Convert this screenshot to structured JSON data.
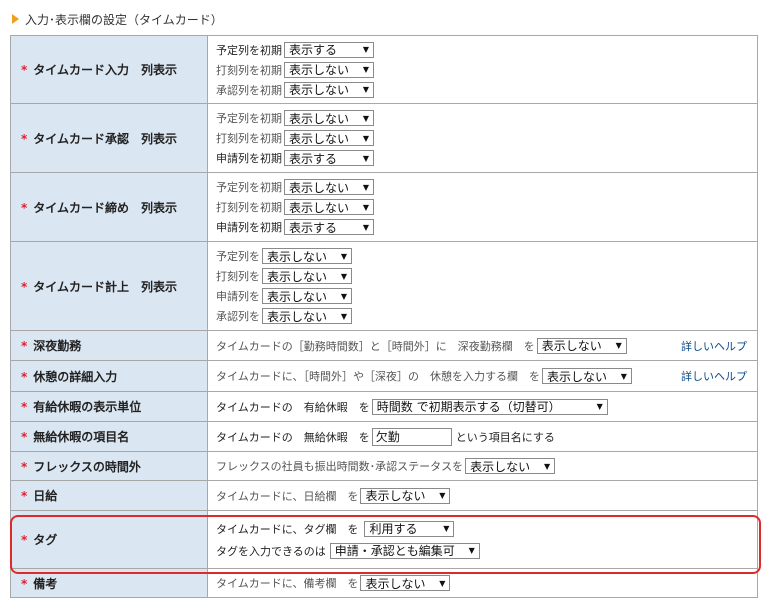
{
  "section": {
    "title": "入力･表示欄の設定（タイムカード）"
  },
  "rows": [
    {
      "label": "タイムカード入力　列表示",
      "lines": [
        {
          "text": "予定列を初期",
          "value": "表示する"
        },
        {
          "text": "打刻列を初期",
          "value": "表示しない"
        },
        {
          "text": "承認列を初期",
          "value": "表示しない"
        }
      ]
    },
    {
      "label": "タイムカード承認　列表示",
      "lines": [
        {
          "text": "予定列を初期",
          "value": "表示しない"
        },
        {
          "text": "打刻列を初期",
          "value": "表示しない"
        },
        {
          "text": "申請列を初期",
          "value": "表示する"
        }
      ]
    },
    {
      "label": "タイムカード締め　列表示",
      "lines": [
        {
          "text": "予定列を初期",
          "value": "表示しない"
        },
        {
          "text": "打刻列を初期",
          "value": "表示しない"
        },
        {
          "text": "申請列を初期",
          "value": "表示する"
        }
      ]
    },
    {
      "label": "タイムカード計上　列表示",
      "lines": [
        {
          "text": "予定列を",
          "value": "表示しない"
        },
        {
          "text": "打刻列を",
          "value": "表示しない"
        },
        {
          "text": "申請列を",
          "value": "表示しない"
        },
        {
          "text": "承認列を",
          "value": "表示しない"
        }
      ]
    },
    {
      "label": "深夜勤務",
      "text": "タイムカードの［勤務時間数］と［時間外］に　深夜勤務欄　を",
      "value": "表示しない",
      "help": "詳しいヘルプ"
    },
    {
      "label": "休憩の詳細入力",
      "text": "タイムカードに、［時間外］や［深夜］の　休憩を入力する欄　を",
      "value": "表示しない",
      "help": "詳しいヘルプ"
    },
    {
      "label": "有給休暇の表示単位",
      "text": "タイムカードの　有給休暇　を",
      "value": "時間数 で初期表示する（切替可）"
    },
    {
      "label": "無給休暇の項目名",
      "text": "タイムカードの　無給休暇　を",
      "value": "欠勤",
      "suffix": "という項目名にする"
    },
    {
      "label": "フレックスの時間外",
      "text": "フレックスの社員も振出時間数･承認ステータスを",
      "value": "表示しない"
    },
    {
      "label": "日給",
      "text": "タイムカードに、日給欄　を",
      "value": "表示しない"
    },
    {
      "label": "タグ",
      "lines": [
        {
          "text": "タイムカードに、タグ欄　を",
          "value": "利用する"
        },
        {
          "text": "タグを入力できるのは",
          "value": "申請・承認とも編集可"
        }
      ]
    },
    {
      "label": "備考",
      "text": "タイムカードに、備考欄　を",
      "value": "表示しない"
    }
  ],
  "colors": {
    "label_bg": "#dae6f2",
    "required": "#e0202e",
    "highlight": "#e02a2a",
    "link": "#0a4a8c",
    "section_marker": "#f0a020"
  },
  "icons": {
    "section_marker": "triangle-right-icon",
    "dropdown": "chevron-down-icon"
  }
}
